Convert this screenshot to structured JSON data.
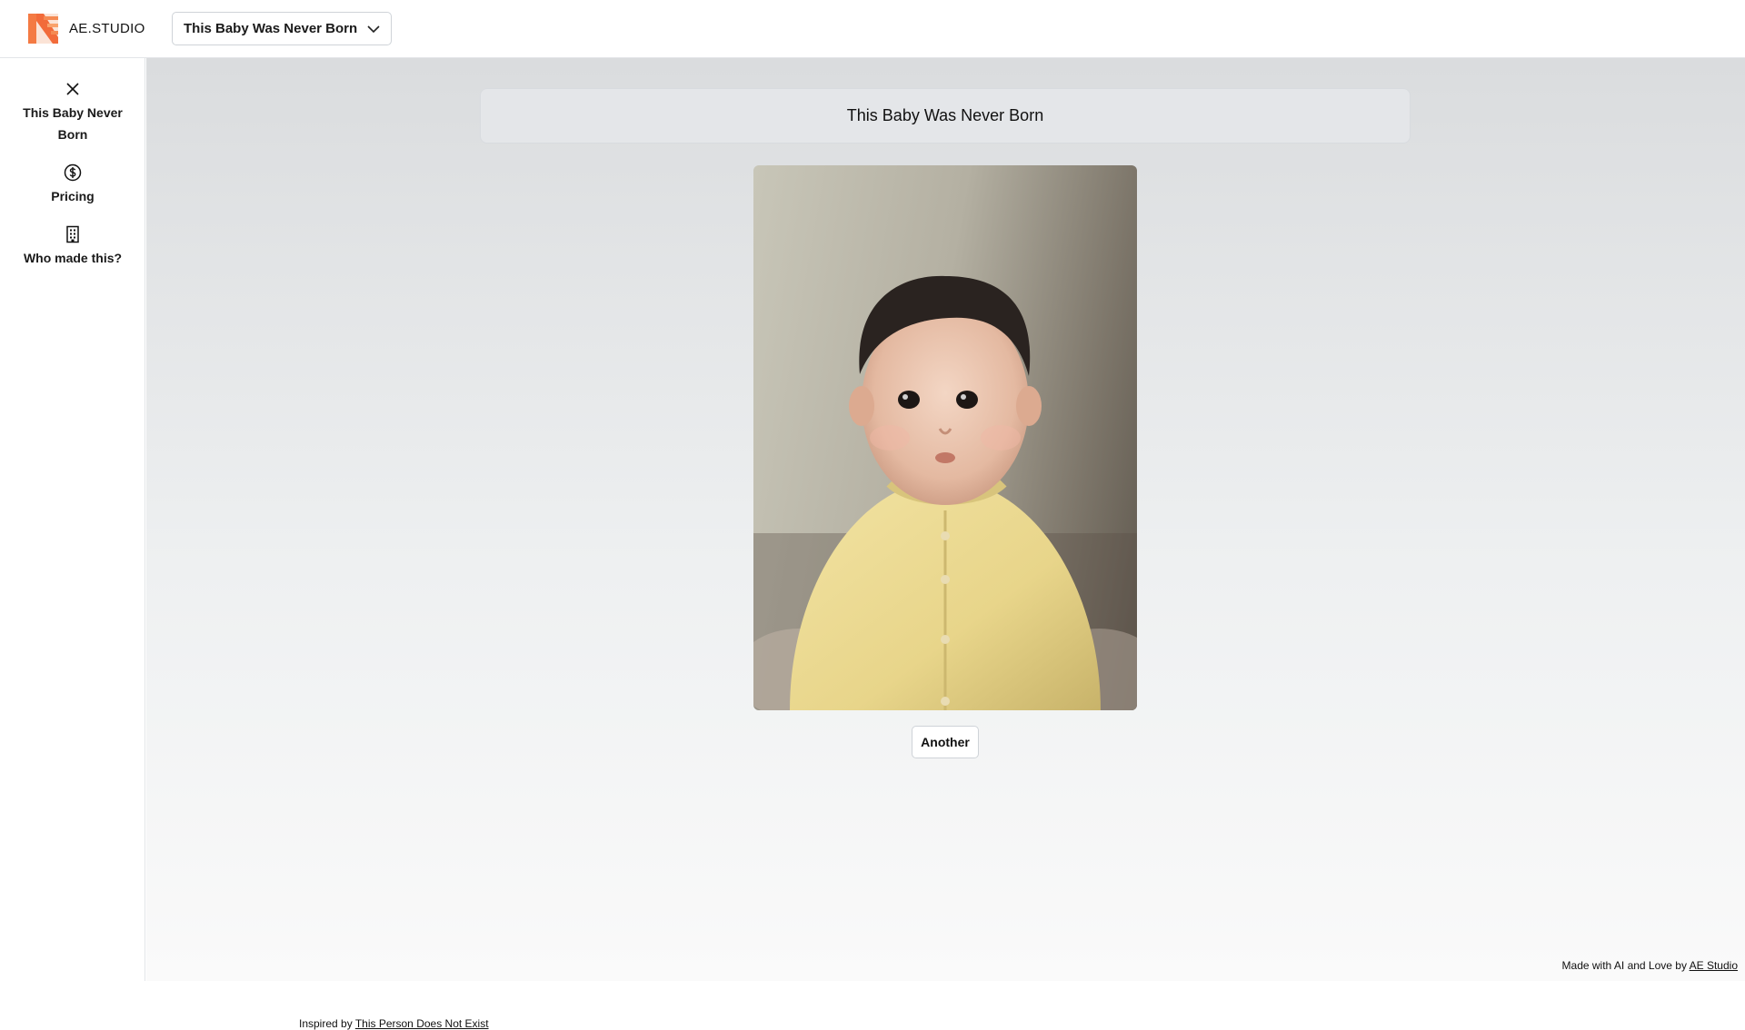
{
  "app": {
    "brand_name": "AE.STUDIO",
    "brand_colors": {
      "primary": "#f26b3a",
      "secondary": "#f9a26c"
    }
  },
  "header": {
    "selector_label": "This Baby Was Never Born"
  },
  "sidebar": {
    "items": [
      {
        "icon": "close-icon",
        "label_line1": "This Baby Never",
        "label_line2": "Born"
      },
      {
        "icon": "dollar-circle-icon",
        "label": "Pricing"
      },
      {
        "icon": "building-icon",
        "label": "Who made this?"
      }
    ]
  },
  "main": {
    "title": "This Baby Was Never Born",
    "image_alt": "AI generated baby portrait",
    "another_label": "Another"
  },
  "footer": {
    "left_prefix": "Inspired by ",
    "left_link": "This Person Does Not Exist",
    "right_prefix": "Made with AI and Love by ",
    "right_link": "AE Studio"
  }
}
